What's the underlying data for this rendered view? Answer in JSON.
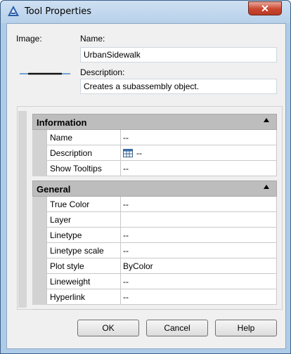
{
  "window": {
    "title": "Tool Properties",
    "close_symbol": "✕",
    "accent_color": "#aecbe8",
    "icon": "autocad-a-icon"
  },
  "form": {
    "image_label": "Image:",
    "name_label": "Name:",
    "name_value": "UrbanSidewalk",
    "description_label": "Description:",
    "description_value": "Creates a subassembly object."
  },
  "grid": {
    "information": {
      "title": "Information",
      "rows": [
        {
          "name": "Name",
          "value": "--"
        },
        {
          "name": "Description",
          "value": "--"
        },
        {
          "name": "Show Tooltips",
          "value": "--"
        }
      ]
    },
    "general": {
      "title": "General",
      "rows": [
        {
          "name": "True Color",
          "value": "--"
        },
        {
          "name": "Layer",
          "value": ""
        },
        {
          "name": "Linetype",
          "value": "--"
        },
        {
          "name": "Linetype scale",
          "value": "--"
        },
        {
          "name": "Plot style",
          "value": "ByColor"
        },
        {
          "name": "Lineweight",
          "value": "--"
        },
        {
          "name": "Hyperlink",
          "value": "--"
        }
      ]
    }
  },
  "buttons": {
    "ok": "OK",
    "cancel": "Cancel",
    "help": "Help"
  }
}
